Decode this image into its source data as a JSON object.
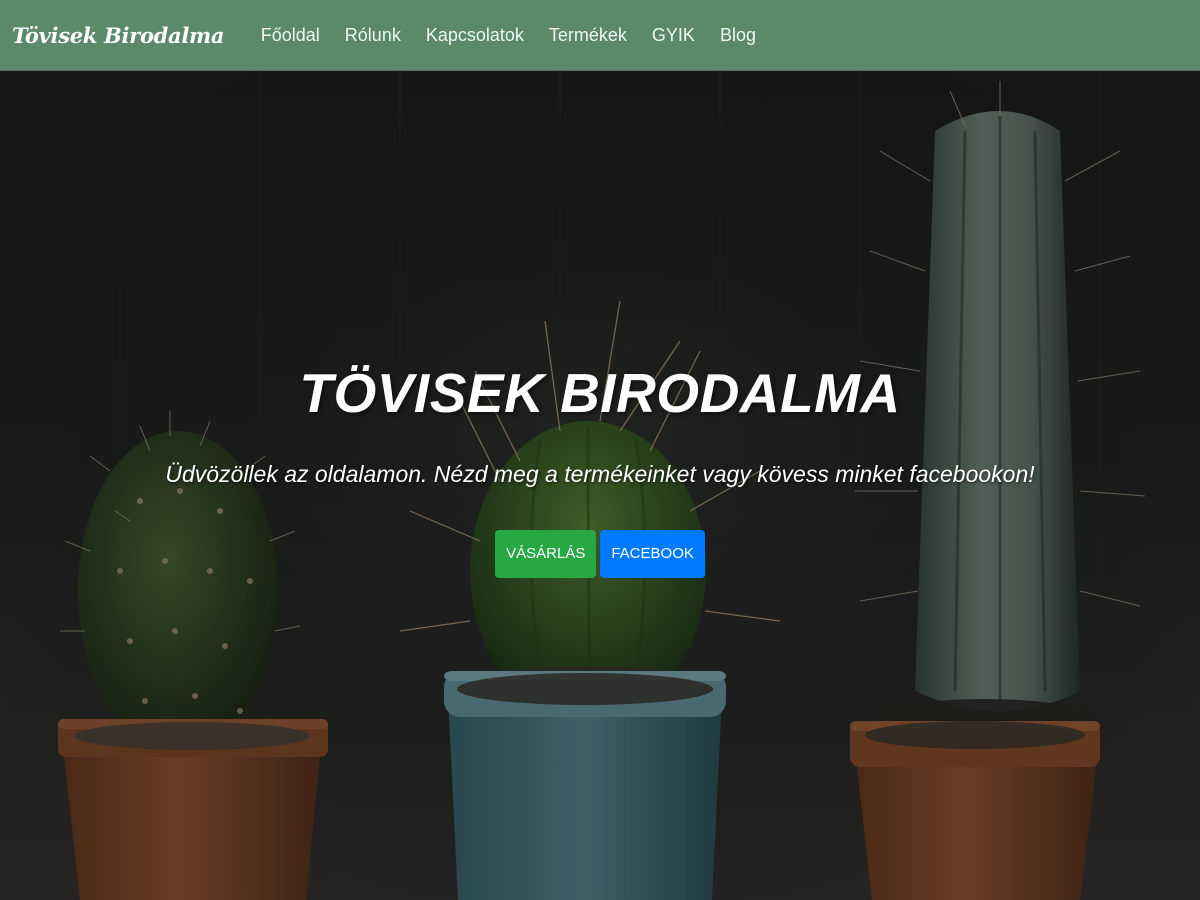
{
  "navbar": {
    "brand": "Tövisek Birodalma",
    "links": [
      "Főoldal",
      "Rólunk",
      "Kapcsolatok",
      "Termékek",
      "GYIK",
      "Blog"
    ]
  },
  "hero": {
    "title": "TÖVISEK BIRODALMA",
    "subtitle": "Üdvözöllek az oldalamon. Nézd meg a termékeinket vagy kövess minket facebookon!",
    "buttons": {
      "shop_label": "VÁSÁRLÁS",
      "facebook_label": "FACEBOOK"
    }
  },
  "colors": {
    "navbar": "#5a8a68",
    "shop_button": "#28a745",
    "facebook_button": "#007bff"
  }
}
